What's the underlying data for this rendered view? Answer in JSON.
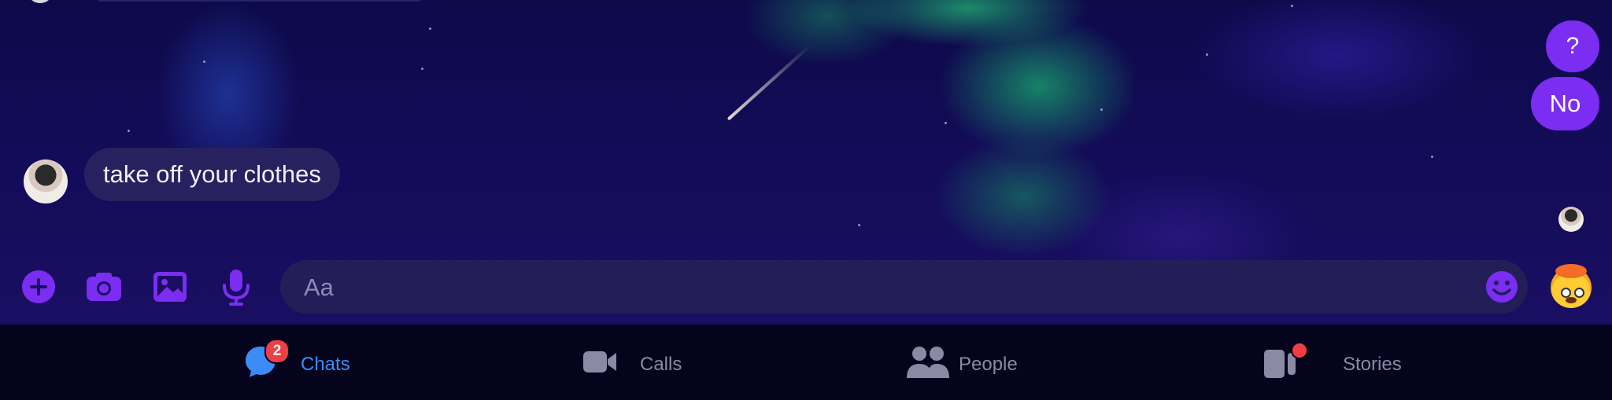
{
  "colors": {
    "accent": "#7b2df2",
    "nav_active": "#3b8df5",
    "nav_inactive": "#8b89a3",
    "badge": "#ee3e46",
    "incoming_bubble": "#27225f"
  },
  "messages": {
    "incoming": [
      {
        "text": "take off your clothes",
        "avatar": "contact-avatar"
      }
    ],
    "outgoing": [
      {
        "text": "?"
      },
      {
        "text": "No"
      }
    ]
  },
  "composer": {
    "buttons": [
      "plus-icon",
      "camera-icon",
      "gallery-icon",
      "microphone-icon"
    ],
    "placeholder": "Aa",
    "value": "",
    "emoji_icon": "smiley-icon",
    "quick_reaction": "exploding-head-emoji"
  },
  "bottom_nav": {
    "items": [
      {
        "label": "Chats",
        "icon": "chat-bubble-icon",
        "badge": "2",
        "active": true
      },
      {
        "label": "Calls",
        "icon": "video-camera-icon",
        "active": false
      },
      {
        "label": "People",
        "icon": "people-icon",
        "active": false
      },
      {
        "label": "Stories",
        "icon": "stories-icon",
        "dot": true,
        "active": false
      }
    ]
  }
}
